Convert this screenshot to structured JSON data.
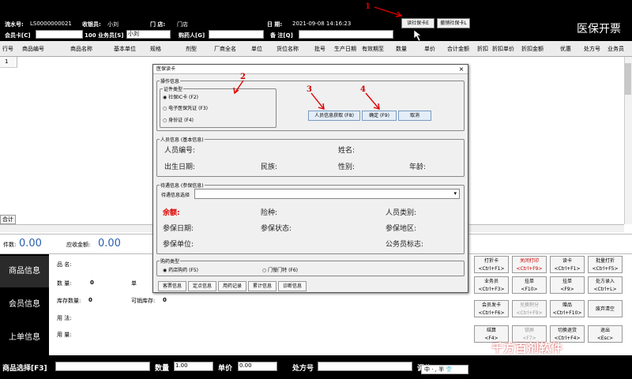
{
  "header": {
    "serial_label": "流水号:",
    "serial_value": "LS0000000021",
    "cashier_label": "收银员:",
    "cashier_value": "小刘",
    "store_label": "门  店:",
    "store_value": "门店",
    "date_label": "日  期:",
    "date_value": "2021-09-08 14:16:23",
    "member_card_label": "会员卡[C]",
    "salesman_label": "100 业务员[S]",
    "salesman_value": "小刘",
    "buyer_label": "购药人[G]",
    "note_label": "备  注[Q]",
    "read_card_btn": "读社保卡E",
    "cancel_read_btn": "撤销社保卡L",
    "title_right": "医保开票"
  },
  "columns": [
    "行号",
    "商品编号",
    "商品名称",
    "基本单位",
    "规格",
    "剂型",
    "厂商全名",
    "单位",
    "货位名称",
    "批号",
    "生产日期",
    "有效期至",
    "数量",
    "单价",
    "合计金额",
    "折扣",
    "折扣单价",
    "折扣金额",
    "优惠",
    "处方号",
    "业务员"
  ],
  "grid": {
    "row_one": "1",
    "total_label": "合计"
  },
  "summary": {
    "count_label": "件数:",
    "count_value": "0.00",
    "amount_label": "应收金额:",
    "amount_value": "0.00"
  },
  "left_tabs": [
    "商品信息",
    "会员信息",
    "上单信息"
  ],
  "product_info": {
    "name_label": "品      名:",
    "qty_label": "数      量:",
    "qty_value": "0",
    "unit_label": "单",
    "stock_label": "库存数量:",
    "stock_value": "0",
    "sellable_label": "可销库存:",
    "sellable_value": "0",
    "usage_label": "用      法:",
    "dose_label": "用      量:"
  },
  "keypad": [
    {
      "label": "打折卡",
      "key": "<Ctrl+F1>"
    },
    {
      "label": "关闭打印",
      "key": "<Ctrl+F9>"
    },
    {
      "label": "读卡",
      "key": "<Ctrl+F1>"
    },
    {
      "label": "批量打折",
      "key": "<Ctrl+F5>"
    },
    {
      "label": "业务员",
      "key": "<Ctrl+F3>"
    },
    {
      "label": "挂单",
      "key": "<F10>"
    },
    {
      "label": "挂单",
      "key": "<F9>"
    },
    {
      "label": "处方录入",
      "key": "<Ctrl+L>"
    },
    {
      "label": "会员发卡",
      "key": "<Ctrl+F6>"
    },
    {
      "label": "兑换积分",
      "key": "<Ctrl+F9>"
    },
    {
      "label": "赠品",
      "key": "<Ctrl+F10>"
    },
    {
      "label": "废弃清空",
      "key": ""
    },
    {
      "label": "结算",
      "key": "<F4>"
    },
    {
      "label": "锁屏",
      "key": "<F7>"
    },
    {
      "label": "切换退货",
      "key": "<Ctrl+F4>"
    },
    {
      "label": "退出",
      "key": "<Esc>"
    }
  ],
  "bottom": {
    "product_select_label": "商品选择[F3]",
    "qty_label": "数量",
    "qty_value": "1.00",
    "price_label": "单价",
    "price_value": "0.00",
    "rx_label": "处方号",
    "change_label": "调价",
    "ime_text": "中 · , 半 👕"
  },
  "watermark": "千方百剂软件",
  "dialog": {
    "title": "医保读卡",
    "close": "×",
    "op_group": "操作信息",
    "id_type_group": "证件类型",
    "radios": [
      "社保IC卡 (F2)",
      "电子医保凭证 (F3)",
      "身份证  (F4)"
    ],
    "btn_fetch": "人员信息获取 (F8)",
    "btn_ok": "确定 (F9)",
    "btn_cancel": "取消",
    "person_group": "人员信息 (基本信息)",
    "person_no": "人员编号:",
    "name": "姓名:",
    "birth": "出生日期:",
    "ethnic": "民族:",
    "gender": "性别:",
    "age": "年龄:",
    "treat_group": "待遇信息 (参保信息)",
    "treat_select": "待遇信息选择",
    "balance": "余额:",
    "insurance_type": "险种:",
    "person_category": "人员类别:",
    "insure_date": "参保日期:",
    "insure_status": "参保状态:",
    "insure_region": "参保地区:",
    "insure_unit": "参保单位:",
    "civil_flag": "公务员标志:",
    "purchase_group": "购药类型",
    "purchase_radios": [
      "药店购药 (F5)",
      "门慢门特 (F6)"
    ],
    "tabs": [
      "客票信息",
      "定点信息",
      "用药记录",
      "累计信息",
      "诊断信息"
    ]
  },
  "annotations": [
    "1",
    "2",
    "3",
    "4"
  ]
}
